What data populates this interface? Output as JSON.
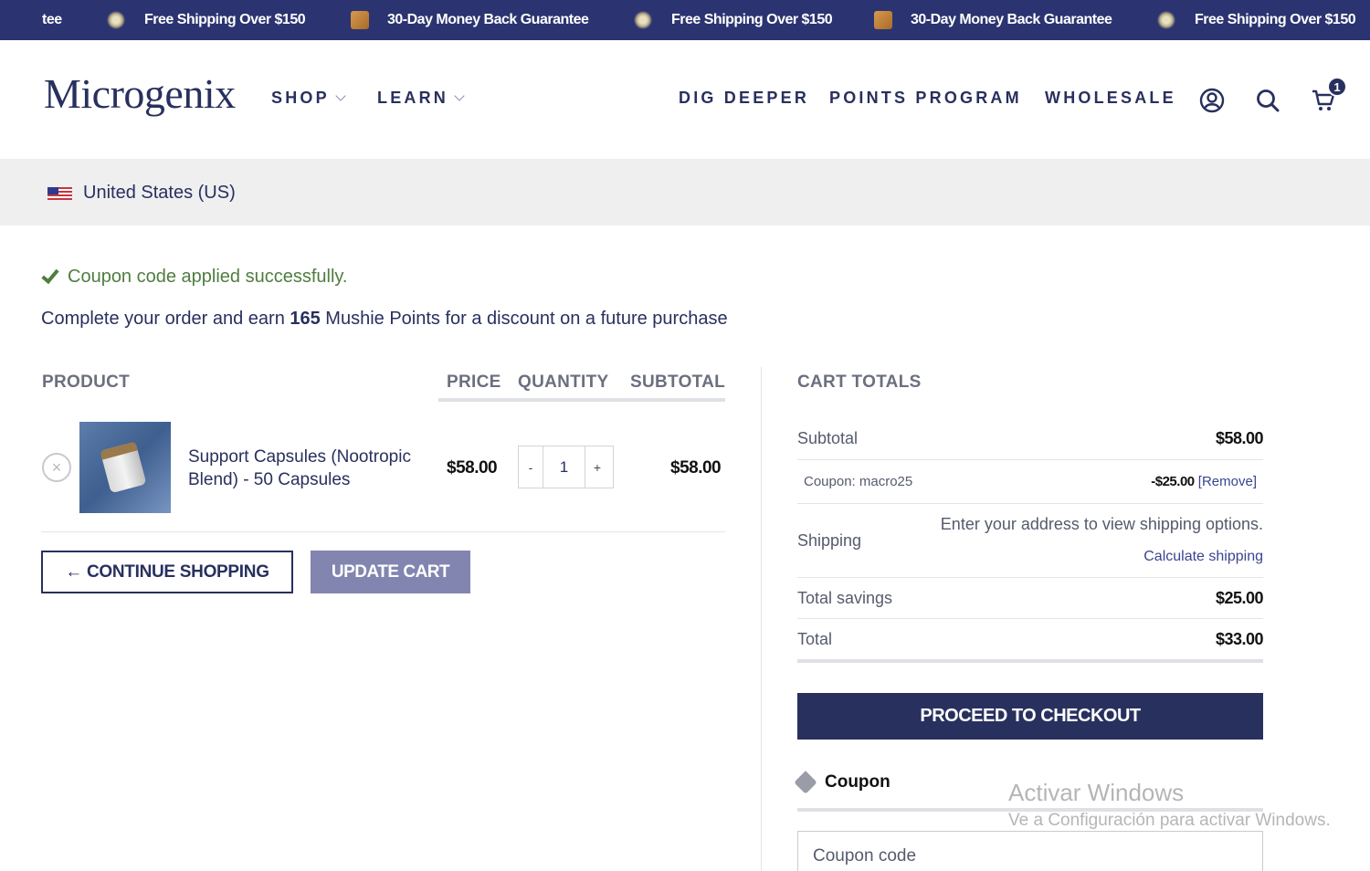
{
  "promo_bar": {
    "items": [
      {
        "text": "tee",
        "icon": "none"
      },
      {
        "text": "Free Shipping Over $150",
        "icon": "leaf-icon"
      },
      {
        "text": "30-Day Money Back Guarantee",
        "icon": "box-icon"
      },
      {
        "text": "Free Shipping Over $150",
        "icon": "leaf-icon"
      },
      {
        "text": "30-Day Money Back Guarantee",
        "icon": "box-icon"
      },
      {
        "text": "Free Shipping Over $150",
        "icon": "leaf-icon"
      }
    ]
  },
  "header": {
    "logo": "Microgenix",
    "nav": [
      {
        "label": "SHOP",
        "dropdown": true
      },
      {
        "label": "LEARN",
        "dropdown": true
      },
      {
        "label": "DIG DEEPER",
        "dropdown": false
      },
      {
        "label": "POINTS PROGRAM",
        "dropdown": false
      },
      {
        "label": "WHOLESALE",
        "dropdown": false
      }
    ],
    "icons": [
      "account-icon",
      "search-icon",
      "cart-icon"
    ],
    "cart_count": "1"
  },
  "country": {
    "label": "United States (US)"
  },
  "notices": {
    "success": "Coupon code applied successfully.",
    "points_prefix": "Complete your order and earn ",
    "points_value": "165",
    "points_suffix": " Mushie Points for a discount on a future purchase"
  },
  "cart": {
    "headers": {
      "product": "PRODUCT",
      "price": "PRICE",
      "quantity": "QUANTITY",
      "subtotal": "SUBTOTAL"
    },
    "items": [
      {
        "name": "Support Capsules (Nootropic Blend) - 50 Capsules",
        "price": "$58.00",
        "quantity": "1",
        "subtotal": "$58.00"
      }
    ],
    "qty_minus": "-",
    "qty_plus": "+",
    "remove_glyph": "×",
    "continue_label": "← CONTINUE SHOPPING",
    "update_label": "UPDATE CART"
  },
  "totals": {
    "title": "CART TOTALS",
    "subtotal_label": "Subtotal",
    "subtotal_value": "$58.00",
    "coupon_label": "Coupon: macro25",
    "coupon_value": "-$25.00",
    "coupon_remove": "[Remove]",
    "shipping_label": "Shipping",
    "shipping_note": "Enter your address to view shipping options.",
    "calc_shipping": "Calculate shipping",
    "savings_label": "Total savings",
    "savings_value": "$25.00",
    "total_label": "Total",
    "total_value": "$33.00",
    "checkout_label": "PROCEED TO CHECKOUT"
  },
  "coupon": {
    "heading": "Coupon",
    "placeholder": "Coupon code"
  },
  "watermark": {
    "line1": "Activar Windows",
    "line2": "Ve a Configuración para activar Windows."
  },
  "colors": {
    "brand_navy": "#28305e",
    "promo_bar": "#2b3470",
    "update_button": "#8185b0",
    "success_green": "#4f7d3f"
  }
}
